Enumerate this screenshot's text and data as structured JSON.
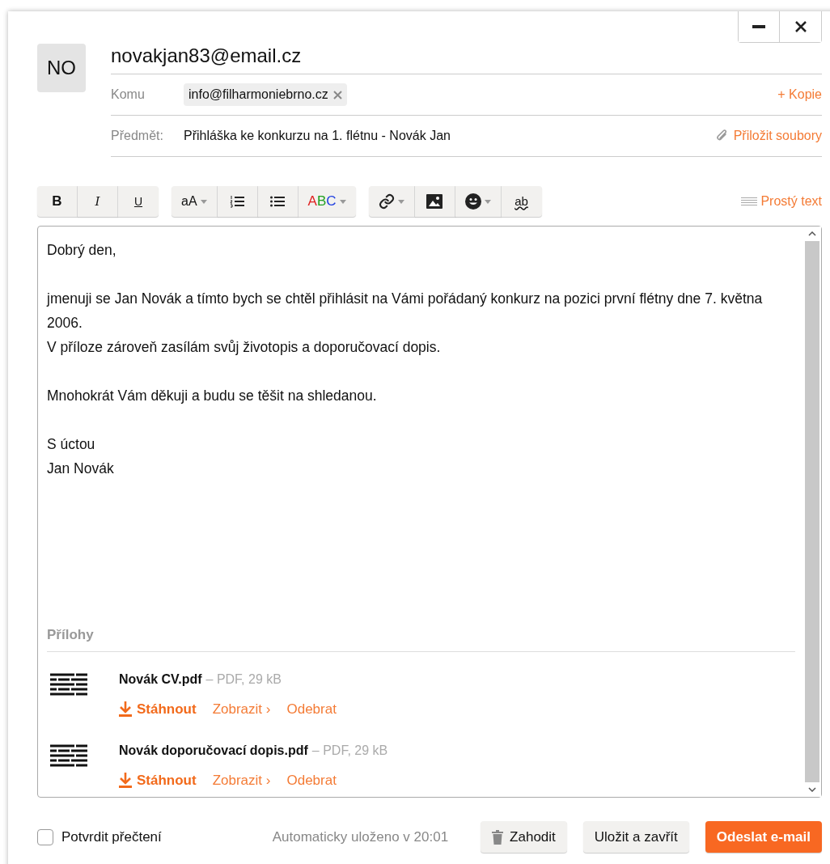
{
  "window_controls": [
    {
      "kind": "minimize"
    },
    {
      "kind": "close"
    }
  ],
  "avatar": {
    "initials": "NO"
  },
  "from": "novakjan83@email.cz",
  "to": {
    "label": "Komu",
    "recipients": [
      "info@filharmoniebrno.cz"
    ],
    "add_copy": "+ Kopie"
  },
  "subject": {
    "label": "Předmět:",
    "value": "Přihláška ke konkurzu na 1. flétnu - Novák Jan",
    "attach": "Přiložit soubory"
  },
  "toolbar": {
    "groups": [
      [
        {
          "kind": "bold",
          "label": "B"
        },
        {
          "kind": "italic",
          "label": "I"
        },
        {
          "kind": "underline",
          "label": "U"
        }
      ],
      [
        {
          "kind": "font-size",
          "label": "aA"
        },
        {
          "kind": "numbered-list"
        },
        {
          "kind": "bullet-list"
        },
        {
          "kind": "color",
          "label": "ABC"
        }
      ],
      [
        {
          "kind": "link"
        },
        {
          "kind": "image"
        },
        {
          "kind": "emoji"
        },
        {
          "kind": "spellcheck",
          "label": "ab"
        }
      ]
    ],
    "plain_text": "Prostý text"
  },
  "body": {
    "paragraphs": [
      [
        "Dobrý den,"
      ],
      [
        "jmenuji se Jan Novák a tímto bych se chtěl přihlásit na Vámi pořádaný konkurz na pozici první flétny dne 7. května 2006.",
        "V příloze zároveň zasílám svůj životopis a doporučovací dopis."
      ],
      [
        "Mnohokrát Vám děkuji a budu se těšit na shledanou."
      ],
      [
        "S úctou",
        "Jan Novák"
      ]
    ]
  },
  "attachments": {
    "title": "Přílohy",
    "files": [
      {
        "name": "Novák CV.pdf",
        "meta": "– PDF, 29 kB",
        "actions": [
          "Stáhnout",
          "Zobrazit ›",
          "Odebrat"
        ]
      },
      {
        "name": "Novák doporučovací dopis.pdf",
        "meta": "– PDF, 29 kB",
        "actions": [
          "Stáhnout",
          "Zobrazit ›",
          "Odebrat"
        ]
      }
    ]
  },
  "footer": {
    "read_receipt": {
      "label": "Potvrdit přečtení",
      "checked": false
    },
    "autosave": "Automaticky uloženo v 20:01",
    "buttons": [
      {
        "kind": "discard",
        "label": "Zahodit"
      },
      {
        "kind": "save",
        "label": "Uložit a zavřít"
      },
      {
        "kind": "send",
        "label": "Odeslat e-mail"
      }
    ]
  }
}
